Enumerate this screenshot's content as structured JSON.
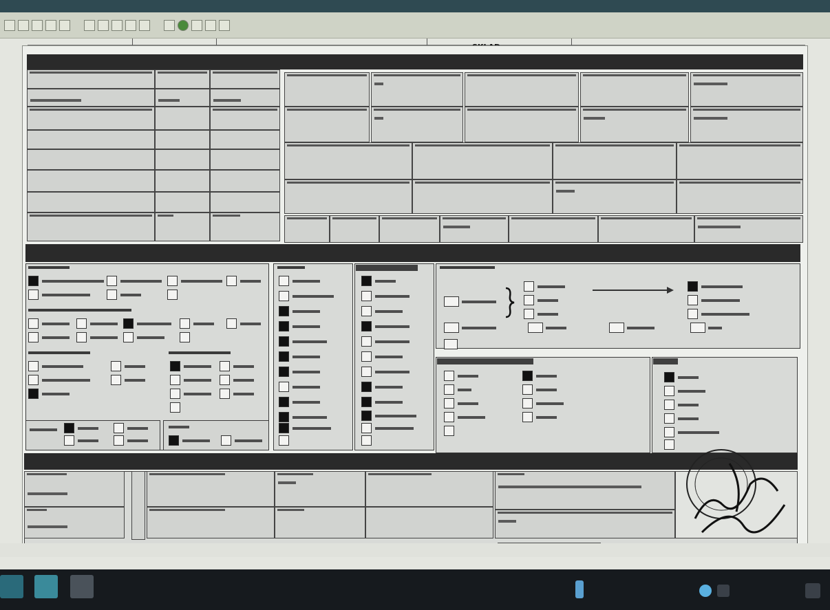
{
  "window": {
    "title": "",
    "page_heading": "SKLAD"
  },
  "toolbar": {
    "buttons": [
      "zoom-in-icon",
      "zoom-out-icon",
      "save-icon",
      "print-icon",
      "copy-icon",
      "first-page-icon",
      "prev-page-icon",
      "next-page-icon",
      "last-page-icon",
      "refresh-icon",
      "go-icon",
      "settings-icon",
      "help-icon"
    ]
  },
  "status_bar": {
    "items": [
      "",
      "",
      "",
      ""
    ]
  },
  "taskbar": {
    "tray_label": "",
    "clock_time": "",
    "clock_date": ""
  },
  "colors": {
    "band": "#2a2a2a",
    "paper": "#eef0ec",
    "taskbar": "#161a1e",
    "titlebar": "#2f4a52"
  }
}
